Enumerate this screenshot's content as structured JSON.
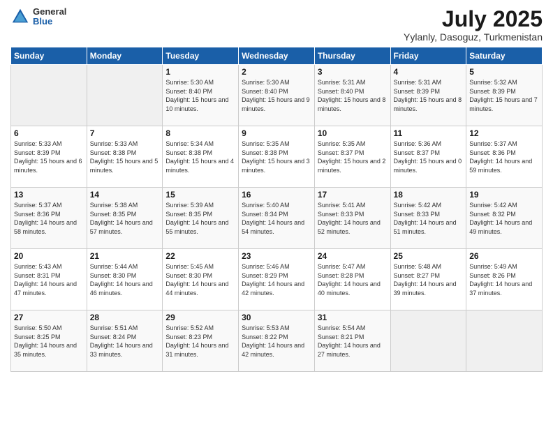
{
  "logo": {
    "general": "General",
    "blue": "Blue"
  },
  "header": {
    "title": "July 2025",
    "subtitle": "Yylanly, Dasoguz, Turkmenistan"
  },
  "weekdays": [
    "Sunday",
    "Monday",
    "Tuesday",
    "Wednesday",
    "Thursday",
    "Friday",
    "Saturday"
  ],
  "weeks": [
    [
      {
        "day": "",
        "empty": true
      },
      {
        "day": "",
        "empty": true
      },
      {
        "day": "1",
        "sunrise": "Sunrise: 5:30 AM",
        "sunset": "Sunset: 8:40 PM",
        "daylight": "Daylight: 15 hours and 10 minutes."
      },
      {
        "day": "2",
        "sunrise": "Sunrise: 5:30 AM",
        "sunset": "Sunset: 8:40 PM",
        "daylight": "Daylight: 15 hours and 9 minutes."
      },
      {
        "day": "3",
        "sunrise": "Sunrise: 5:31 AM",
        "sunset": "Sunset: 8:40 PM",
        "daylight": "Daylight: 15 hours and 8 minutes."
      },
      {
        "day": "4",
        "sunrise": "Sunrise: 5:31 AM",
        "sunset": "Sunset: 8:39 PM",
        "daylight": "Daylight: 15 hours and 8 minutes."
      },
      {
        "day": "5",
        "sunrise": "Sunrise: 5:32 AM",
        "sunset": "Sunset: 8:39 PM",
        "daylight": "Daylight: 15 hours and 7 minutes."
      }
    ],
    [
      {
        "day": "6",
        "sunrise": "Sunrise: 5:33 AM",
        "sunset": "Sunset: 8:39 PM",
        "daylight": "Daylight: 15 hours and 6 minutes."
      },
      {
        "day": "7",
        "sunrise": "Sunrise: 5:33 AM",
        "sunset": "Sunset: 8:38 PM",
        "daylight": "Daylight: 15 hours and 5 minutes."
      },
      {
        "day": "8",
        "sunrise": "Sunrise: 5:34 AM",
        "sunset": "Sunset: 8:38 PM",
        "daylight": "Daylight: 15 hours and 4 minutes."
      },
      {
        "day": "9",
        "sunrise": "Sunrise: 5:35 AM",
        "sunset": "Sunset: 8:38 PM",
        "daylight": "Daylight: 15 hours and 3 minutes."
      },
      {
        "day": "10",
        "sunrise": "Sunrise: 5:35 AM",
        "sunset": "Sunset: 8:37 PM",
        "daylight": "Daylight: 15 hours and 2 minutes."
      },
      {
        "day": "11",
        "sunrise": "Sunrise: 5:36 AM",
        "sunset": "Sunset: 8:37 PM",
        "daylight": "Daylight: 15 hours and 0 minutes."
      },
      {
        "day": "12",
        "sunrise": "Sunrise: 5:37 AM",
        "sunset": "Sunset: 8:36 PM",
        "daylight": "Daylight: 14 hours and 59 minutes."
      }
    ],
    [
      {
        "day": "13",
        "sunrise": "Sunrise: 5:37 AM",
        "sunset": "Sunset: 8:36 PM",
        "daylight": "Daylight: 14 hours and 58 minutes."
      },
      {
        "day": "14",
        "sunrise": "Sunrise: 5:38 AM",
        "sunset": "Sunset: 8:35 PM",
        "daylight": "Daylight: 14 hours and 57 minutes."
      },
      {
        "day": "15",
        "sunrise": "Sunrise: 5:39 AM",
        "sunset": "Sunset: 8:35 PM",
        "daylight": "Daylight: 14 hours and 55 minutes."
      },
      {
        "day": "16",
        "sunrise": "Sunrise: 5:40 AM",
        "sunset": "Sunset: 8:34 PM",
        "daylight": "Daylight: 14 hours and 54 minutes."
      },
      {
        "day": "17",
        "sunrise": "Sunrise: 5:41 AM",
        "sunset": "Sunset: 8:33 PM",
        "daylight": "Daylight: 14 hours and 52 minutes."
      },
      {
        "day": "18",
        "sunrise": "Sunrise: 5:42 AM",
        "sunset": "Sunset: 8:33 PM",
        "daylight": "Daylight: 14 hours and 51 minutes."
      },
      {
        "day": "19",
        "sunrise": "Sunrise: 5:42 AM",
        "sunset": "Sunset: 8:32 PM",
        "daylight": "Daylight: 14 hours and 49 minutes."
      }
    ],
    [
      {
        "day": "20",
        "sunrise": "Sunrise: 5:43 AM",
        "sunset": "Sunset: 8:31 PM",
        "daylight": "Daylight: 14 hours and 47 minutes."
      },
      {
        "day": "21",
        "sunrise": "Sunrise: 5:44 AM",
        "sunset": "Sunset: 8:30 PM",
        "daylight": "Daylight: 14 hours and 46 minutes."
      },
      {
        "day": "22",
        "sunrise": "Sunrise: 5:45 AM",
        "sunset": "Sunset: 8:30 PM",
        "daylight": "Daylight: 14 hours and 44 minutes."
      },
      {
        "day": "23",
        "sunrise": "Sunrise: 5:46 AM",
        "sunset": "Sunset: 8:29 PM",
        "daylight": "Daylight: 14 hours and 42 minutes."
      },
      {
        "day": "24",
        "sunrise": "Sunrise: 5:47 AM",
        "sunset": "Sunset: 8:28 PM",
        "daylight": "Daylight: 14 hours and 40 minutes."
      },
      {
        "day": "25",
        "sunrise": "Sunrise: 5:48 AM",
        "sunset": "Sunset: 8:27 PM",
        "daylight": "Daylight: 14 hours and 39 minutes."
      },
      {
        "day": "26",
        "sunrise": "Sunrise: 5:49 AM",
        "sunset": "Sunset: 8:26 PM",
        "daylight": "Daylight: 14 hours and 37 minutes."
      }
    ],
    [
      {
        "day": "27",
        "sunrise": "Sunrise: 5:50 AM",
        "sunset": "Sunset: 8:25 PM",
        "daylight": "Daylight: 14 hours and 35 minutes."
      },
      {
        "day": "28",
        "sunrise": "Sunrise: 5:51 AM",
        "sunset": "Sunset: 8:24 PM",
        "daylight": "Daylight: 14 hours and 33 minutes."
      },
      {
        "day": "29",
        "sunrise": "Sunrise: 5:52 AM",
        "sunset": "Sunset: 8:23 PM",
        "daylight": "Daylight: 14 hours and 31 minutes."
      },
      {
        "day": "30",
        "sunrise": "Sunrise: 5:53 AM",
        "sunset": "Sunset: 8:22 PM",
        "daylight": "Daylight: 14 hours and 42 minutes."
      },
      {
        "day": "31",
        "sunrise": "Sunrise: 5:54 AM",
        "sunset": "Sunset: 8:21 PM",
        "daylight": "Daylight: 14 hours and 27 minutes."
      },
      {
        "day": "",
        "empty": true
      },
      {
        "day": "",
        "empty": true
      }
    ]
  ]
}
